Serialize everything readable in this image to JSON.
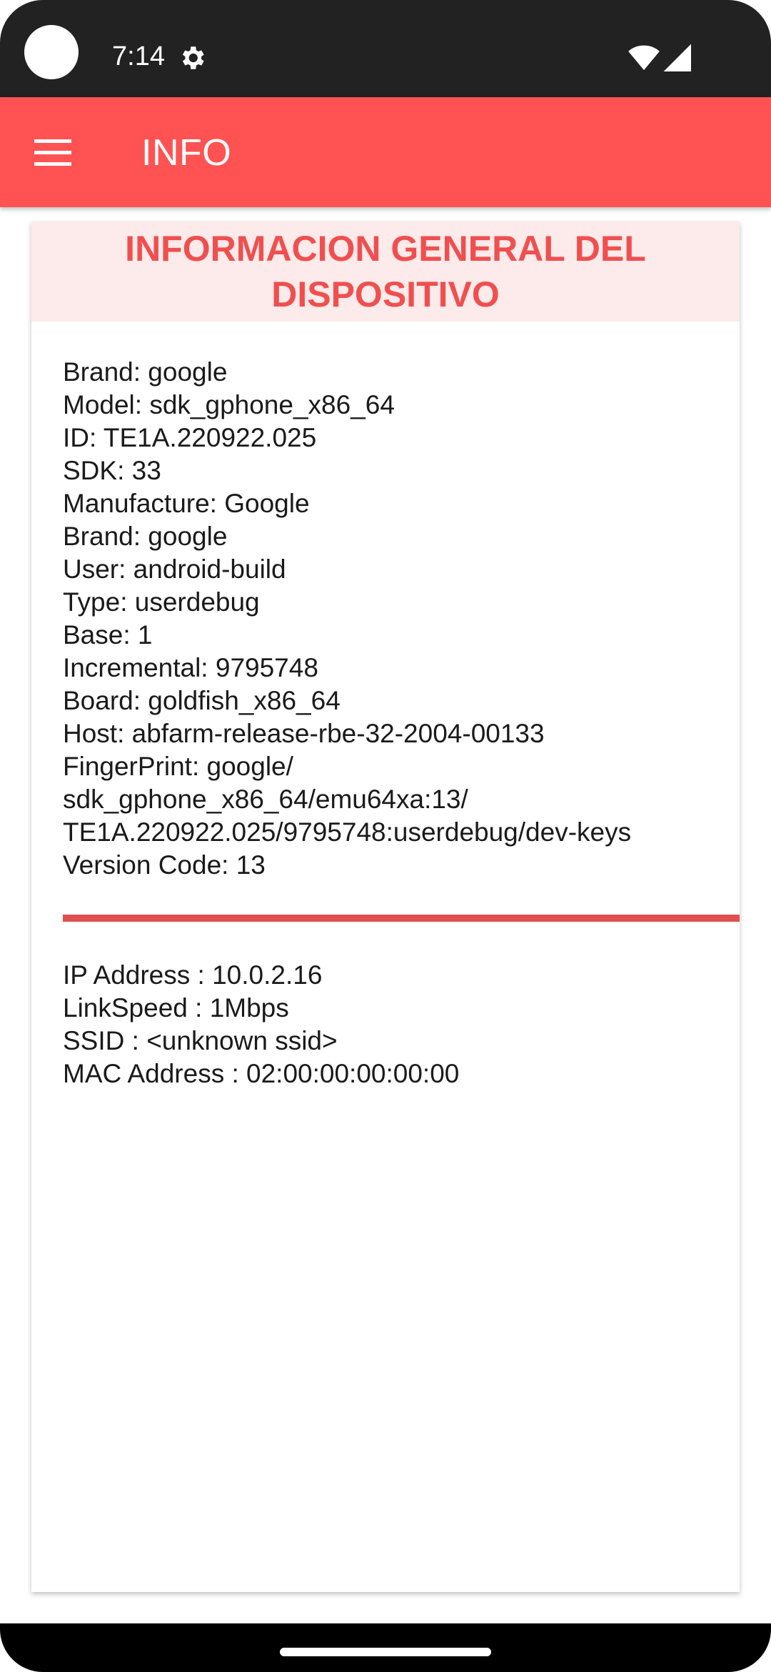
{
  "status_bar": {
    "time": "7:14",
    "icons": [
      "camera-dot",
      "gear-icon",
      "wifi-icon",
      "signal-icon"
    ]
  },
  "app_bar": {
    "title": "INFO",
    "menu_icon": "hamburger-menu-icon",
    "color": "#fe5352"
  },
  "card": {
    "title": "INFORMACION GENERAL DEL DISPOSITIVO",
    "header_bg": "#fdeaea",
    "title_color": "#f04f4f",
    "device_info": [
      "Brand: google",
      "Model: sdk_gphone_x86_64",
      "ID: TE1A.220922.025",
      "SDK: 33",
      "Manufacture: Google",
      "Brand: google",
      "User: android-build",
      "Type: userdebug",
      "Base: 1",
      "Incremental: 9795748",
      "Board: goldfish_x86_64",
      "Host: abfarm-release-rbe-32-2004-00133",
      "FingerPrint: google/",
      "sdk_gphone_x86_64/emu64xa:13/",
      "TE1A.220922.025/9795748:userdebug/dev-keys",
      "Version Code: 13"
    ],
    "divider_color": "#e05050",
    "network_info": [
      "IP Address : 10.0.2.16",
      "LinkSpeed : 1Mbps",
      "SSID : <unknown ssid>",
      "MAC Address : 02:00:00:00:00:00"
    ]
  }
}
